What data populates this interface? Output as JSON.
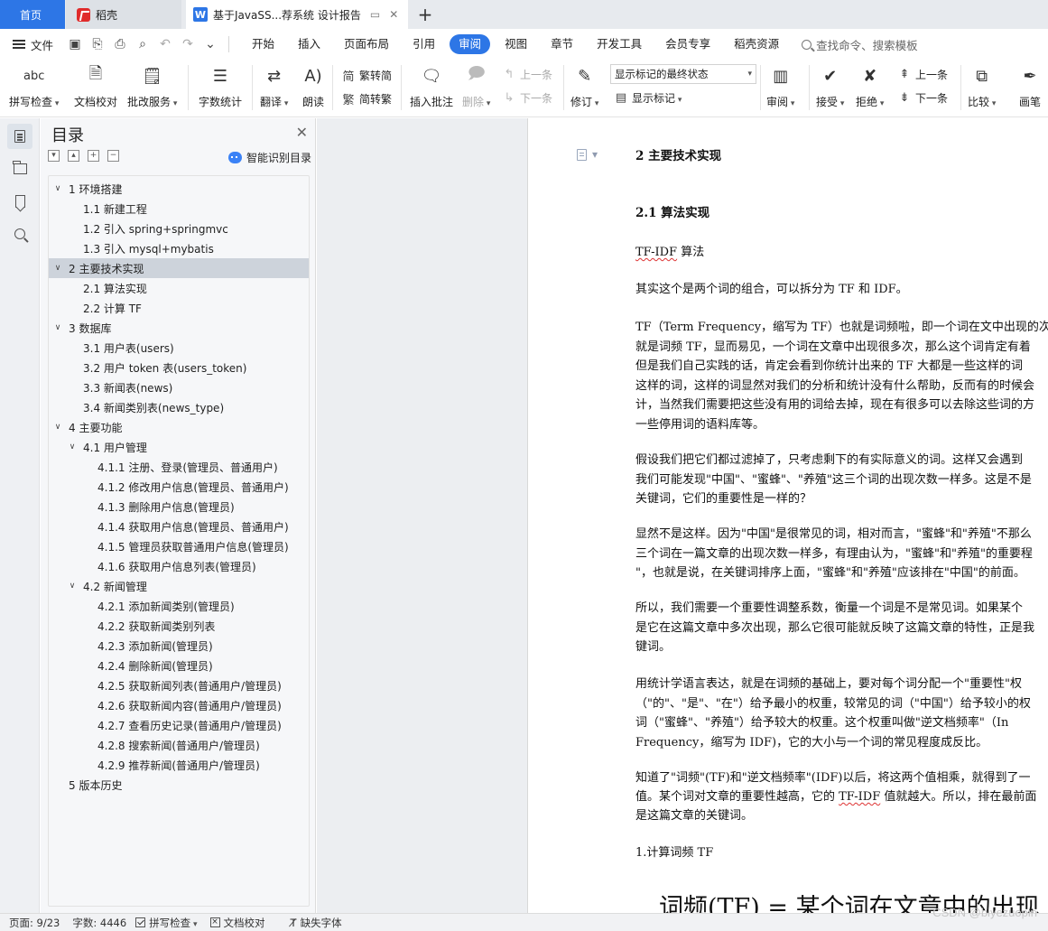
{
  "tabs": {
    "home": "首页",
    "daoke": "稻壳",
    "doc": "基于JavaSS...荐系统 设计报告"
  },
  "menu": {
    "file": "文件",
    "items": [
      "开始",
      "插入",
      "页面布局",
      "引用",
      "审阅",
      "视图",
      "章节",
      "开发工具",
      "会员专享",
      "稻壳资源"
    ],
    "active": "审阅",
    "search": "查找命令、搜索模板"
  },
  "ribbon": {
    "spell_check": "拼写检查",
    "doc_proof": "文档校对",
    "annotate_service": "批改服务",
    "word_count": "字数统计",
    "translate": "翻译",
    "read_aloud": "朗读",
    "trad_to_simp": "繁转简",
    "simp_to_trad": "简转繁",
    "insert_comment": "插入批注",
    "delete": "删除",
    "prev": "上一条",
    "next": "下一条",
    "revise": "修订",
    "markup_state": "显示标记的最终状态",
    "show_markup": "显示标记",
    "review": "审阅",
    "accept": "接受",
    "reject": "拒绝",
    "prev2": "上一条",
    "next2": "下一条",
    "compare": "比较",
    "ink": "画笔"
  },
  "toc": {
    "title": "目录",
    "smart": "智能识别目录",
    "items": [
      {
        "text": "1  环境搭建",
        "level": 1,
        "twisty": "∨"
      },
      {
        "text": "1.1  新建工程",
        "level": 2
      },
      {
        "text": "1.2  引入 spring+springmvc",
        "level": 2
      },
      {
        "text": "1.3  引入 mysql+mybatis",
        "level": 2
      },
      {
        "text": "2  主要技术实现",
        "level": 1,
        "twisty": "∨",
        "selected": true
      },
      {
        "text": "2.1  算法实现",
        "level": 2
      },
      {
        "text": "2.2  计算 TF",
        "level": 2
      },
      {
        "text": "3  数据库",
        "level": 1,
        "twisty": "∨"
      },
      {
        "text": "3.1  用户表(users)",
        "level": 2
      },
      {
        "text": "3.2  用户 token 表(users_token)",
        "level": 2
      },
      {
        "text": "3.3  新闻表(news)",
        "level": 2
      },
      {
        "text": "3.4  新闻类别表(news_type)",
        "level": 2
      },
      {
        "text": "4  主要功能",
        "level": 1,
        "twisty": "∨"
      },
      {
        "text": "4.1  用户管理",
        "level": 2,
        "twisty": "∨"
      },
      {
        "text": "4.1.1  注册、登录(管理员、普通用户)",
        "level": 3
      },
      {
        "text": "4.1.2  修改用户信息(管理员、普通用户)",
        "level": 3
      },
      {
        "text": "4.1.3  删除用户信息(管理员)",
        "level": 3
      },
      {
        "text": "4.1.4  获取用户信息(管理员、普通用户)",
        "level": 3
      },
      {
        "text": "4.1.5  管理员获取普通用户信息(管理员)",
        "level": 3
      },
      {
        "text": "4.1.6  获取用户信息列表(管理员)",
        "level": 3
      },
      {
        "text": "4.2  新闻管理",
        "level": 2,
        "twisty": "∨"
      },
      {
        "text": "4.2.1  添加新闻类别(管理员)",
        "level": 3
      },
      {
        "text": "4.2.2  获取新闻类别列表",
        "level": 3
      },
      {
        "text": "4.2.3  添加新闻(管理员)",
        "level": 3
      },
      {
        "text": "4.2.4  删除新闻(管理员)",
        "level": 3
      },
      {
        "text": "4.2.5  获取新闻列表(普通用户/管理员)",
        "level": 3
      },
      {
        "text": "4.2.6  获取新闻内容(普通用户/管理员)",
        "level": 3
      },
      {
        "text": "4.2.7  查看历史记录(普通用户/管理员)",
        "level": 3
      },
      {
        "text": "4.2.8  搜索新闻(普通用户/管理员)",
        "level": 3
      },
      {
        "text": "4.2.9  推荐新闻(普通用户/管理员)",
        "level": 3
      },
      {
        "text": "5  版本历史",
        "level": 1
      }
    ]
  },
  "document": {
    "h1": "2  主要技术实现",
    "h2": "2.1  算法实现",
    "tfidf_label_a": "TF-IDF",
    "tfidf_label_b": " 算法",
    "p1": "其实这个是两个词的组合，可以拆分为 TF 和 IDF。",
    "p2": [
      "TF（Term Frequency，缩写为 TF）也就是词频啦，即一个词在文中出现的次",
      "就是词频 TF，显而易见，一个词在文章中出现很多次，那么这个词肯定有着",
      "但是我们自己实践的话，肯定会看到你统计出来的 TF 大都是一些这样的词",
      "这样的词，这样的词显然对我们的分析和统计没有什么帮助，反而有的时候会",
      "计，当然我们需要把这些没有用的词给去掉，现在有很多可以去除这些词的方",
      "一些停用词的语料库等。"
    ],
    "p3": [
      "假设我们把它们都过滤掉了，只考虑剩下的有实际意义的词。这样又会遇到",
      "我们可能发现\"中国\"、\"蜜蜂\"、\"养殖\"这三个词的出现次数一样多。这是不是",
      "关键词，它们的重要性是一样的？"
    ],
    "p4": [
      "显然不是这样。因为\"中国\"是很常见的词，相对而言，\"蜜蜂\"和\"养殖\"不那么",
      "三个词在一篇文章的出现次数一样多，有理由认为，\"蜜蜂\"和\"养殖\"的重要程",
      "\"，也就是说，在关键词排序上面，\"蜜蜂\"和\"养殖\"应该排在\"中国\"的前面。"
    ],
    "p5": [
      "所以，我们需要一个重要性调整系数，衡量一个词是不是常见词。如果某个",
      "是它在这篇文章中多次出现，那么它很可能就反映了这篇文章的特性，正是我",
      "键词。"
    ],
    "p6": [
      "用统计学语言表达，就是在词频的基础上，要对每个词分配一个\"重要性\"权",
      "（\"的\"、\"是\"、\"在\"）给予最小的权重，较常见的词（\"中国\"）给予较小的权",
      "词（\"蜜蜂\"、\"养殖\"）给予较大的权重。这个权重叫做\"逆文档频率\"（In",
      "Frequency，缩写为 IDF)，它的大小与一个词的常见程度成反比。"
    ],
    "p7a": "知道了\"词频\"(TF)和\"逆文档频率\"(IDF)以后，将这两个值相乘，就得到了一",
    "p7b_pre": "值。某个词对文章的重要性越高，它的 ",
    "p7b_sq": "TF-IDF",
    "p7b_post": " 值就越大。所以，排在最前面",
    "p7c": "是这篇文章的关键词。",
    "p8": "1.计算词频 TF",
    "formula": "词频(TF) = 某个词在文章中的出现"
  },
  "status": {
    "page": "页面: 9/23",
    "words": "字数: 4446",
    "spell": "拼写检查",
    "proof": "文档校对",
    "missing_font": "缺失字体"
  },
  "watermark": "CSDN @biyezuopin"
}
